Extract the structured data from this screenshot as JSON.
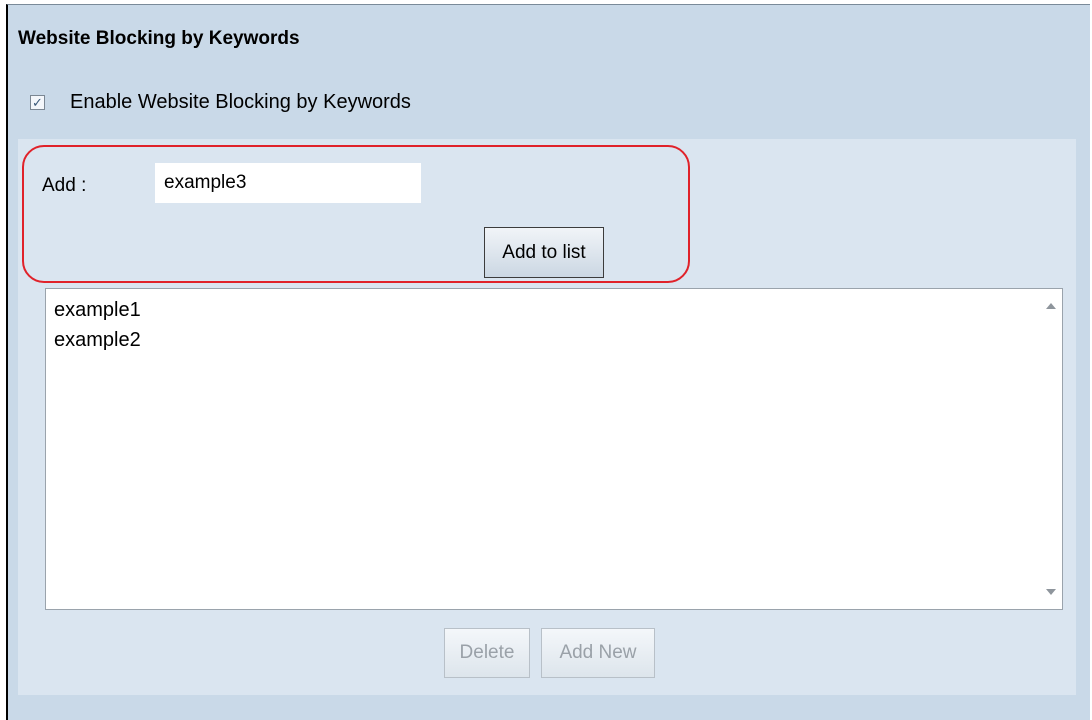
{
  "section": {
    "title": "Website Blocking by Keywords"
  },
  "enable": {
    "label": "Enable Website Blocking by Keywords",
    "checked": true,
    "check_glyph": "✓"
  },
  "add": {
    "label": "Add :",
    "value": "example3",
    "button_label": "Add to list"
  },
  "list": {
    "items": [
      "example1",
      "example2"
    ]
  },
  "actions": {
    "delete_label": "Delete",
    "add_new_label": "Add New"
  },
  "colors": {
    "panel_bg": "#c9d9e8",
    "inner_bg": "#dae5f0",
    "highlight": "#e0222a"
  },
  "icons": {
    "checkbox": "checkmark-icon",
    "scroll_up": "scroll-up-arrow-icon",
    "scroll_down": "scroll-down-arrow-icon"
  }
}
